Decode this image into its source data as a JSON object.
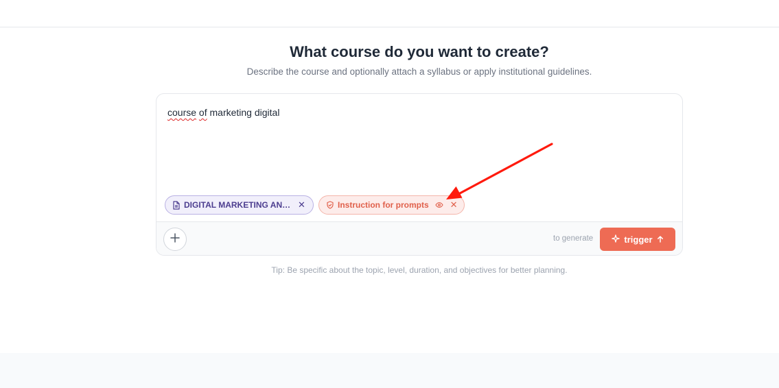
{
  "header": {
    "title": "What course do you want to create?",
    "subtitle": "Describe the course and optionally attach a syllabus or apply institutional guidelines."
  },
  "composer": {
    "prompt_words": [
      "course",
      "of",
      "marketing digital"
    ],
    "attachments": [
      {
        "label": "DIGITAL MARKETING AN…",
        "icon": "document-icon"
      },
      {
        "label": "Instruction for prompts",
        "icon": "shield-check-icon"
      }
    ],
    "hint": "to generate",
    "trigger_label": "trigger"
  },
  "tip": "Tip: Be specific about the topic, level, duration, and objectives for better planning.",
  "colors": {
    "accent": "#ee6b54",
    "syllabus_chip": "#4c3d8f",
    "annotation_arrow": "#ff1a0d"
  }
}
